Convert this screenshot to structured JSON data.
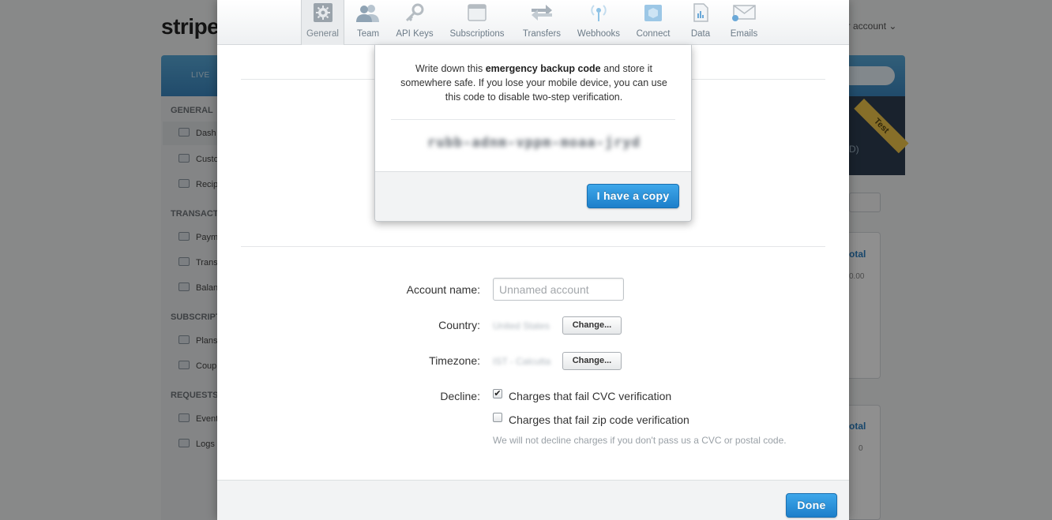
{
  "background": {
    "logo": "stripe",
    "account_menu": "ur account",
    "live_toggle": "LIVE",
    "test_ribbon": "Test",
    "nav": {
      "sections": [
        {
          "heading": "GENERAL",
          "items": [
            "Dash",
            "Custo",
            "Recip"
          ]
        },
        {
          "heading": "TRANSACT",
          "items": [
            "Paym",
            "Trans",
            "Balan"
          ]
        },
        {
          "heading": "SUBSCRIPT",
          "items": [
            "Plans",
            "Coup"
          ]
        },
        {
          "heading": "REQUESTS",
          "items": [
            "Event",
            "Logs"
          ]
        }
      ]
    },
    "hero_sub": "D)",
    "cards": [
      {
        "title": "otal",
        "value": "0.00"
      },
      {
        "title": "otal",
        "value": "0"
      }
    ]
  },
  "modal": {
    "tabs": [
      {
        "label": "General",
        "icon": "gear-icon"
      },
      {
        "label": "Team",
        "icon": "team-icon"
      },
      {
        "label": "API Keys",
        "icon": "key-icon"
      },
      {
        "label": "Subscriptions",
        "icon": "calendar-icon"
      },
      {
        "label": "Transfers",
        "icon": "transfer-arrows-icon"
      },
      {
        "label": "Webhooks",
        "icon": "broadcast-icon"
      },
      {
        "label": "Connect",
        "icon": "cube-icon"
      },
      {
        "label": "Data",
        "icon": "document-chart-icon"
      },
      {
        "label": "Emails",
        "icon": "envelope-icon"
      }
    ],
    "active_tab": "General",
    "form": {
      "account_name_label": "Account name:",
      "account_name_placeholder": "Unnamed account",
      "account_name_value": "",
      "country_label": "Country:",
      "country_value": "United States",
      "country_change": "Change...",
      "timezone_label": "Timezone:",
      "timezone_value": "IST - Calcutta",
      "timezone_change": "Change...",
      "decline_label": "Decline:",
      "decline_cvc_label": "Charges that fail CVC verification",
      "decline_cvc_checked": true,
      "decline_zip_label": "Charges that fail zip code verification",
      "decline_zip_checked": false,
      "hint": "We will not decline charges if you don't pass us a CVC or postal code."
    },
    "done_label": "Done"
  },
  "popover": {
    "message_before": "Write down this ",
    "message_bold": "emergency backup code",
    "message_after": " and store it somewhere safe. If you lose your mobile device, you can use this code to disable two-step verification.",
    "backup_code": "rubb-adnm-vppm-moaa-jryd",
    "confirm_label": "I have a copy"
  },
  "colors": {
    "primary_button": "#1d7fca",
    "tab_text": "#6c7b88",
    "link_blue": "#2c7fc0",
    "test_ribbon": "#f1c64a"
  }
}
